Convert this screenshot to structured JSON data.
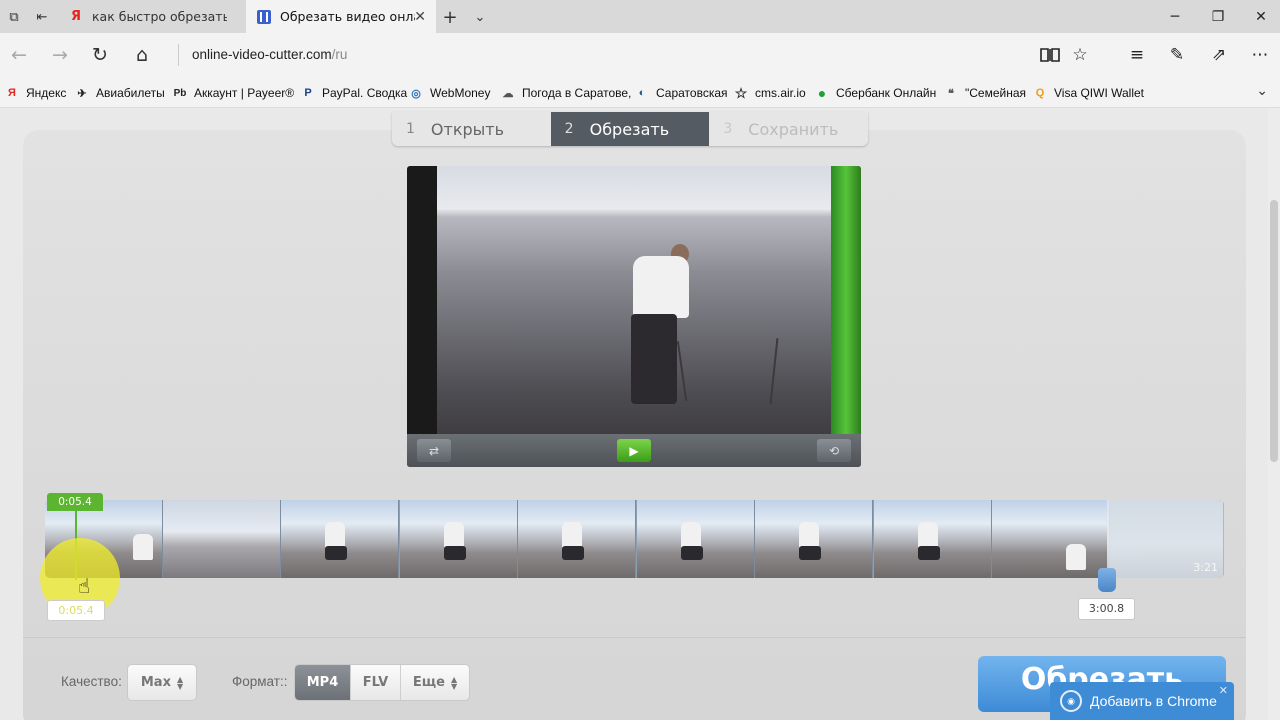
{
  "browser": {
    "tabs": [
      {
        "title": "как быстро обрезать видео",
        "icon": "yandex-icon"
      },
      {
        "title": "Обрезать видео онлайн",
        "icon": "video-cutter-icon"
      }
    ],
    "url_host": "online-video-cutter.com",
    "url_path": "/ru",
    "favorites": [
      {
        "label": "Яндекс",
        "icon": "yandex-icon",
        "color": "#e52620",
        "glyph": "Я"
      },
      {
        "label": "Авиабилеты",
        "icon": "plane-icon",
        "color": "#222222",
        "glyph": "✈"
      },
      {
        "label": "Аккаунт | Payeer®",
        "icon": "payeer-icon",
        "color": "#222222",
        "glyph": "Pb"
      },
      {
        "label": "PayPal. Сводка",
        "icon": "paypal-icon",
        "color": "#1b3f8f",
        "glyph": "P"
      },
      {
        "label": "WebMoney",
        "icon": "webmoney-icon",
        "color": "#2a6fb7",
        "glyph": "◎"
      },
      {
        "label": "Погода в Саратове,",
        "icon": "weather-icon",
        "color": "#555555",
        "glyph": "☁"
      },
      {
        "label": "Саратовская",
        "icon": "saratov-icon",
        "color": "#1e5a8c",
        "glyph": "◐"
      },
      {
        "label": "cms.air.io",
        "icon": "star-icon",
        "color": "#333333",
        "glyph": "☆"
      },
      {
        "label": "Сбербанк Онлайн",
        "icon": "sberbank-icon",
        "color": "#21a038",
        "glyph": "●"
      },
      {
        "label": "\"Семейная",
        "icon": "semeynaya-icon",
        "color": "#555555",
        "glyph": "❝"
      },
      {
        "label": "Visa QIWI Wallet",
        "icon": "qiwi-icon",
        "color": "#f49b15",
        "glyph": "Q"
      }
    ]
  },
  "steps": [
    {
      "num": "1",
      "label": "Открыть",
      "state": "done"
    },
    {
      "num": "2",
      "label": "Обрезать",
      "state": "active"
    },
    {
      "num": "3",
      "label": "Сохранить",
      "state": "disabled"
    }
  ],
  "timeline": {
    "start_tag": "0:05.4",
    "start_value": "0:05.4",
    "end_value": "3:00.8",
    "duration": "3:21"
  },
  "settings": {
    "quality_label": "Качество:",
    "quality_value": "Max",
    "format_label": "Формат::",
    "formats": [
      "MP4",
      "FLV"
    ],
    "format_selected": "MP4",
    "more_label": "Еще"
  },
  "cut_button": "Обрезать",
  "chrome_toast": "Добавить в Chrome",
  "colors": {
    "accent_green": "#5cb531",
    "accent_blue": "#4a8fd9",
    "step_active": "#555b62"
  }
}
